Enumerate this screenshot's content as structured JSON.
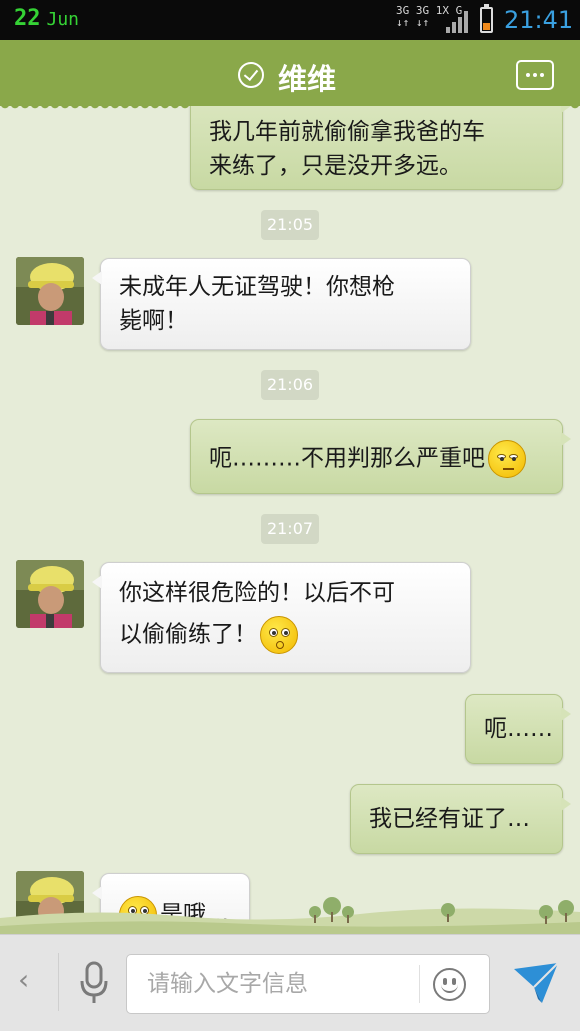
{
  "status_bar": {
    "day": "22",
    "month": "Jun",
    "network_top": "3G 3G 1X G",
    "network_bottom": "↓↑ ↓↑",
    "time": "21:41"
  },
  "header": {
    "title": "维维",
    "online_icon": "check-circle-icon",
    "more_icon": "more-dots-icon"
  },
  "messages": [
    {
      "type": "out",
      "text_line1": "我几年前就偷偷拿我爸的车",
      "text_line2": "来练了，只是没开多远。"
    },
    {
      "type": "time",
      "text": "21:05"
    },
    {
      "type": "in",
      "text_line1": "未成年人无证驾驶！你想枪",
      "text_line2": "毙啊！"
    },
    {
      "type": "time",
      "text": "21:06"
    },
    {
      "type": "out",
      "text": "呃………不用判那么严重吧",
      "emoji": "smug-face-emoji"
    },
    {
      "type": "time",
      "text": "21:07"
    },
    {
      "type": "in",
      "text_line1": "你这样很危险的！以后不可",
      "text_line2": "以偷偷练了！",
      "emoji": "surprised-face-emoji"
    },
    {
      "type": "out",
      "text": "呃……"
    },
    {
      "type": "out",
      "text": "我已经有证了…"
    },
    {
      "type": "in",
      "text": "是哦…",
      "emoji": "rolling-eyes-emoji"
    }
  ],
  "input_bar": {
    "back_label": "‹",
    "placeholder": "请输入文字信息",
    "value": ""
  },
  "colors": {
    "header_green": "#8aa84a",
    "outgoing_bubble": "#d4e2b2",
    "incoming_bubble": "#f6f6f6",
    "background": "#e6ecd8",
    "clock_blue": "#3aa0e0",
    "date_green": "#35d235",
    "send_blue": "#2d8fd6"
  }
}
